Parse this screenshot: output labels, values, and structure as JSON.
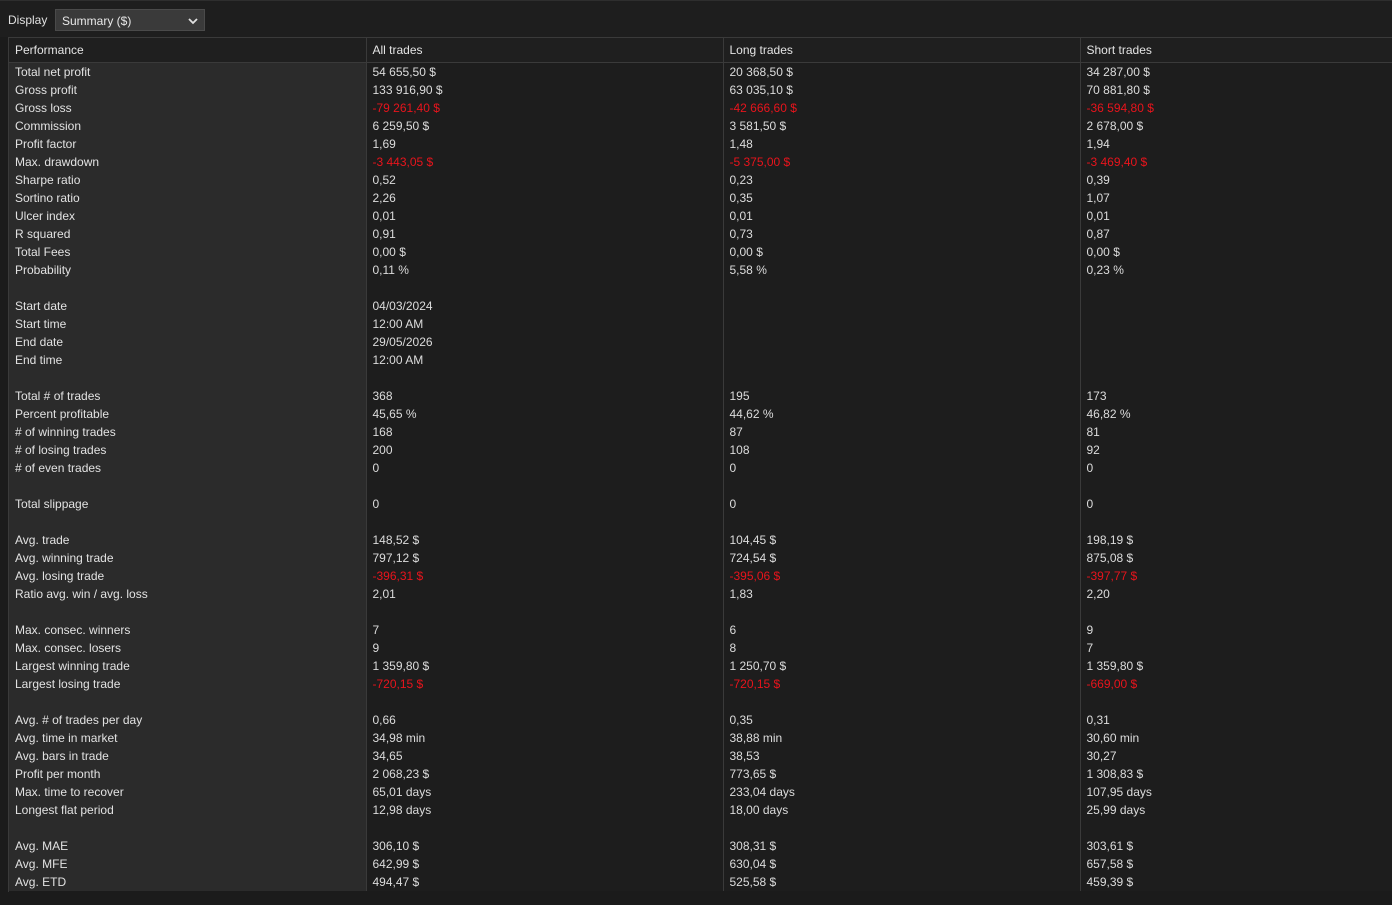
{
  "display": {
    "label": "Display",
    "selected": "Summary ($)"
  },
  "columns": [
    "Performance",
    "All trades",
    "Long trades",
    "Short trades"
  ],
  "colors": {
    "negative": "#e8141c",
    "label_bg": "#2b2b2b",
    "value_bg": "#1d1d1d"
  },
  "rows": [
    {
      "label": "Total net profit",
      "values": [
        "54 655,50 $",
        "20 368,50 $",
        "34 287,00 $"
      ]
    },
    {
      "label": "Gross profit",
      "values": [
        "133 916,90 $",
        "63 035,10 $",
        "70 881,80 $"
      ]
    },
    {
      "label": "Gross loss",
      "values": [
        "-79 261,40 $",
        "-42 666,60 $",
        "-36 594,80 $"
      ]
    },
    {
      "label": "Commission",
      "values": [
        "6 259,50 $",
        "3 581,50 $",
        "2 678,00 $"
      ]
    },
    {
      "label": "Profit factor",
      "values": [
        "1,69",
        "1,48",
        "1,94"
      ]
    },
    {
      "label": "Max. drawdown",
      "values": [
        "-3 443,05 $",
        "-5 375,00 $",
        "-3 469,40 $"
      ]
    },
    {
      "label": "Sharpe ratio",
      "values": [
        "0,52",
        "0,23",
        "0,39"
      ]
    },
    {
      "label": "Sortino ratio",
      "values": [
        "2,26",
        "0,35",
        "1,07"
      ]
    },
    {
      "label": "Ulcer index",
      "values": [
        "0,01",
        "0,01",
        "0,01"
      ]
    },
    {
      "label": "R squared",
      "values": [
        "0,91",
        "0,73",
        "0,87"
      ]
    },
    {
      "label": "Total Fees",
      "values": [
        "0,00 $",
        "0,00 $",
        "0,00 $"
      ]
    },
    {
      "label": "Probability",
      "values": [
        "0,11 %",
        "5,58 %",
        "0,23 %"
      ]
    },
    {
      "spacer": true
    },
    {
      "label": "Start date",
      "values": [
        "04/03/2024",
        "",
        ""
      ]
    },
    {
      "label": "Start time",
      "values": [
        "12:00 AM",
        "",
        ""
      ]
    },
    {
      "label": "End date",
      "values": [
        "29/05/2026",
        "",
        ""
      ]
    },
    {
      "label": "End time",
      "values": [
        "12:00 AM",
        "",
        ""
      ]
    },
    {
      "spacer": true
    },
    {
      "label": "Total # of trades",
      "values": [
        "368",
        "195",
        "173"
      ]
    },
    {
      "label": "Percent profitable",
      "values": [
        "45,65 %",
        "44,62 %",
        "46,82 %"
      ]
    },
    {
      "label": "# of winning trades",
      "values": [
        "168",
        "87",
        "81"
      ]
    },
    {
      "label": "# of losing trades",
      "values": [
        "200",
        "108",
        "92"
      ]
    },
    {
      "label": "# of even trades",
      "values": [
        "0",
        "0",
        "0"
      ]
    },
    {
      "spacer": true
    },
    {
      "label": "Total slippage",
      "values": [
        "0",
        "0",
        "0"
      ]
    },
    {
      "spacer": true
    },
    {
      "label": "Avg. trade",
      "values": [
        "148,52 $",
        "104,45 $",
        "198,19 $"
      ]
    },
    {
      "label": "Avg. winning trade",
      "values": [
        "797,12 $",
        "724,54 $",
        "875,08 $"
      ]
    },
    {
      "label": "Avg. losing trade",
      "values": [
        "-396,31 $",
        "-395,06 $",
        "-397,77 $"
      ]
    },
    {
      "label": "Ratio avg. win / avg. loss",
      "values": [
        "2,01",
        "1,83",
        "2,20"
      ]
    },
    {
      "spacer": true
    },
    {
      "label": "Max. consec. winners",
      "values": [
        "7",
        "6",
        "9"
      ]
    },
    {
      "label": "Max. consec. losers",
      "values": [
        "9",
        "8",
        "7"
      ]
    },
    {
      "label": "Largest winning trade",
      "values": [
        "1 359,80 $",
        "1 250,70 $",
        "1 359,80 $"
      ]
    },
    {
      "label": "Largest losing trade",
      "values": [
        "-720,15 $",
        "-720,15 $",
        "-669,00 $"
      ]
    },
    {
      "spacer": true
    },
    {
      "label": "Avg. # of trades per day",
      "values": [
        "0,66",
        "0,35",
        "0,31"
      ]
    },
    {
      "label": "Avg. time in market",
      "values": [
        "34,98 min",
        "38,88 min",
        "30,60 min"
      ]
    },
    {
      "label": "Avg. bars in trade",
      "values": [
        "34,65",
        "38,53",
        "30,27"
      ]
    },
    {
      "label": "Profit per month",
      "values": [
        "2 068,23 $",
        "773,65 $",
        "1 308,83 $"
      ]
    },
    {
      "label": "Max. time to recover",
      "values": [
        "65,01 days",
        "233,04 days",
        "107,95 days"
      ]
    },
    {
      "label": "Longest flat period",
      "values": [
        "12,98 days",
        "18,00 days",
        "25,99 days"
      ]
    },
    {
      "spacer": true
    },
    {
      "label": "Avg. MAE",
      "values": [
        "306,10 $",
        "308,31 $",
        "303,61 $"
      ]
    },
    {
      "label": "Avg. MFE",
      "values": [
        "642,99 $",
        "630,04 $",
        "657,58 $"
      ]
    },
    {
      "label": "Avg. ETD",
      "values": [
        "494,47 $",
        "525,58 $",
        "459,39 $"
      ]
    }
  ]
}
